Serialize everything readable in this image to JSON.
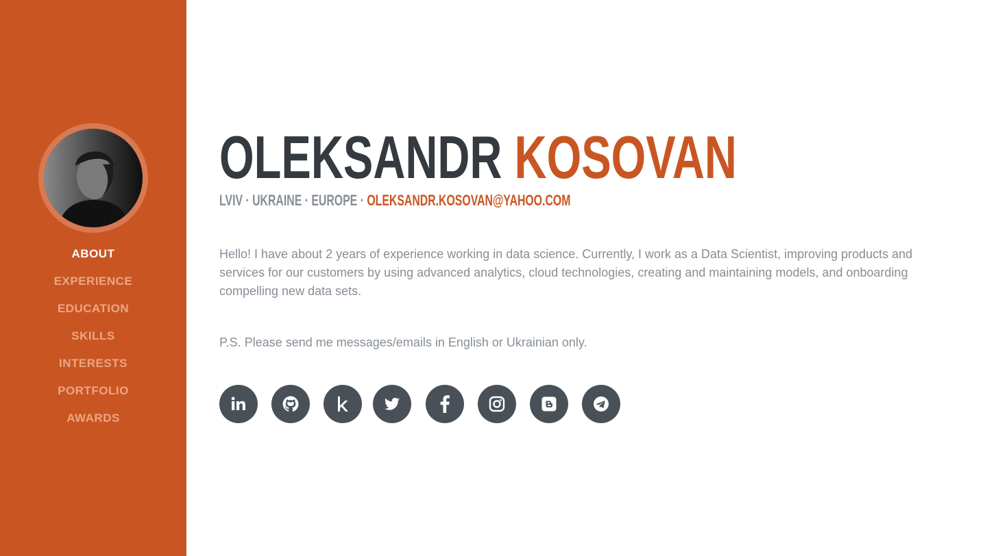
{
  "sidebar": {
    "avatar_alt": "profile photo",
    "nav": [
      {
        "label": "ABOUT",
        "active": true
      },
      {
        "label": "EXPERIENCE",
        "active": false
      },
      {
        "label": "EDUCATION",
        "active": false
      },
      {
        "label": "SKILLS",
        "active": false
      },
      {
        "label": "INTERESTS",
        "active": false
      },
      {
        "label": "PORTFOLIO",
        "active": false
      },
      {
        "label": "AWARDS",
        "active": false
      }
    ]
  },
  "header": {
    "first_name": "OLEKSANDR",
    "last_name": "KOSOVAN",
    "location": "LVIV · UKRAINE · EUROPE · ",
    "email": "OLEKSANDR.KOSOVAN@YAHOO.COM"
  },
  "about": {
    "lead": "Hello! I have about 2 years of experience working in data science. Currently, I work as a Data Scientist, improving products and services for our customers by using advanced analytics, cloud technologies, creating and maintaining models, and onboarding compelling new data sets.",
    "ps": "P.S. Please send me messages/emails in English or Ukrainian only."
  },
  "social": [
    {
      "name": "linkedin-icon"
    },
    {
      "name": "github-icon"
    },
    {
      "name": "kaggle-icon"
    },
    {
      "name": "twitter-icon"
    },
    {
      "name": "facebook-icon"
    },
    {
      "name": "instagram-icon"
    },
    {
      "name": "blogger-icon"
    },
    {
      "name": "telegram-icon"
    }
  ],
  "colors": {
    "primary": "#c95622",
    "dark": "#343a40",
    "muted": "#868e96",
    "icon_bg": "#495057",
    "nav_inactive": "#eca584"
  }
}
